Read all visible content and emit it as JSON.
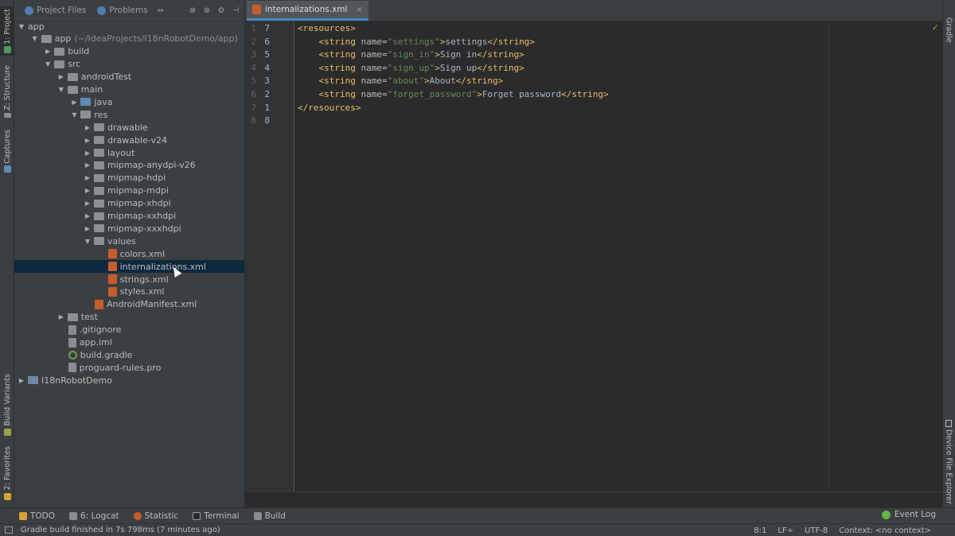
{
  "left_strip": {
    "tabs": [
      {
        "label": "1: Project",
        "icon": "project-icon",
        "active": true
      },
      {
        "label": "Z: Structure",
        "icon": "structure-icon"
      },
      {
        "label": "Captures",
        "icon": "captures-icon"
      },
      {
        "label": "Build Variants",
        "icon": "build-variants-icon"
      },
      {
        "label": "2: Favorites",
        "icon": "star-icon"
      }
    ]
  },
  "right_strip": {
    "tabs": [
      {
        "label": "Gradle",
        "icon": "gradle-icon"
      },
      {
        "label": "Device File Explorer",
        "icon": "device-icon"
      }
    ]
  },
  "project_panel": {
    "tabs": [
      {
        "label": "Project Files",
        "icon": "globe-icon"
      },
      {
        "label": "Problems",
        "icon": "globe-icon"
      }
    ],
    "tools": [
      "swap-icon",
      "collapse-icon",
      "scroll-from-source-icon",
      "gear-icon",
      "hide-icon"
    ],
    "tree": [
      {
        "depth": 0,
        "arrow": "down",
        "icon": "none",
        "label": "app"
      },
      {
        "depth": 1,
        "arrow": "down",
        "icon": "folder",
        "label": "app",
        "extra": "(~/IdeaProjects/I18nRobotDemo/app)"
      },
      {
        "depth": 2,
        "arrow": "right",
        "icon": "folder",
        "label": "build"
      },
      {
        "depth": 2,
        "arrow": "down",
        "icon": "folder",
        "label": "src"
      },
      {
        "depth": 3,
        "arrow": "right",
        "icon": "folder",
        "label": "androidTest"
      },
      {
        "depth": 3,
        "arrow": "down",
        "icon": "folder",
        "label": "main"
      },
      {
        "depth": 4,
        "arrow": "right",
        "icon": "folder-blue",
        "label": "java"
      },
      {
        "depth": 4,
        "arrow": "down",
        "icon": "folder",
        "label": "res"
      },
      {
        "depth": 5,
        "arrow": "right",
        "icon": "folder",
        "label": "drawable"
      },
      {
        "depth": 5,
        "arrow": "right",
        "icon": "folder",
        "label": "drawable-v24"
      },
      {
        "depth": 5,
        "arrow": "right",
        "icon": "folder",
        "label": "layout"
      },
      {
        "depth": 5,
        "arrow": "right",
        "icon": "folder",
        "label": "mipmap-anydpi-v26"
      },
      {
        "depth": 5,
        "arrow": "right",
        "icon": "folder",
        "label": "mipmap-hdpi"
      },
      {
        "depth": 5,
        "arrow": "right",
        "icon": "folder",
        "label": "mipmap-mdpi"
      },
      {
        "depth": 5,
        "arrow": "right",
        "icon": "folder",
        "label": "mipmap-xhdpi"
      },
      {
        "depth": 5,
        "arrow": "right",
        "icon": "folder",
        "label": "mipmap-xxhdpi"
      },
      {
        "depth": 5,
        "arrow": "right",
        "icon": "folder",
        "label": "mipmap-xxxhdpi"
      },
      {
        "depth": 5,
        "arrow": "down",
        "icon": "folder",
        "label": "values"
      },
      {
        "depth": 6,
        "arrow": "none",
        "icon": "xml",
        "label": "colors.xml"
      },
      {
        "depth": 6,
        "arrow": "none",
        "icon": "xml",
        "label": "internalizations.xml",
        "selected": true
      },
      {
        "depth": 6,
        "arrow": "none",
        "icon": "xml",
        "label": "strings.xml"
      },
      {
        "depth": 6,
        "arrow": "none",
        "icon": "xml",
        "label": "styles.xml"
      },
      {
        "depth": 5,
        "arrow": "none",
        "icon": "xml",
        "label": "AndroidManifest.xml"
      },
      {
        "depth": 3,
        "arrow": "right",
        "icon": "folder",
        "label": "test"
      },
      {
        "depth": 3,
        "arrow": "none",
        "icon": "plain",
        "label": ".gitignore"
      },
      {
        "depth": 3,
        "arrow": "none",
        "icon": "plain",
        "label": "app.iml"
      },
      {
        "depth": 3,
        "arrow": "none",
        "icon": "gradle",
        "label": "build.gradle"
      },
      {
        "depth": 3,
        "arrow": "none",
        "icon": "plain",
        "label": "proguard-rules.pro"
      },
      {
        "depth": 0,
        "arrow": "right",
        "icon": "module",
        "label": "I18nRobotDemo"
      }
    ]
  },
  "editor": {
    "tab": {
      "label": "internalizations.xml",
      "icon": "xml-file-icon"
    },
    "gutter": [
      {
        "a": "1",
        "b": "7"
      },
      {
        "a": "2",
        "b": "6"
      },
      {
        "a": "3",
        "b": "5"
      },
      {
        "a": "4",
        "b": "4"
      },
      {
        "a": "5",
        "b": "3"
      },
      {
        "a": "6",
        "b": "2"
      },
      {
        "a": "7",
        "b": "1"
      },
      {
        "a": "8",
        "b": "8"
      }
    ],
    "lines": [
      {
        "indent": "",
        "open": "<resources>",
        "attr": "",
        "val": "",
        "close_open": "",
        "text": "",
        "end": ""
      },
      {
        "indent": "    ",
        "open": "<string",
        "attr": " name=",
        "val": "\"settings\"",
        "close_open": ">",
        "text": "settings",
        "end": "</string>"
      },
      {
        "indent": "    ",
        "open": "<string",
        "attr": " name=",
        "val": "\"sign_in\"",
        "close_open": ">",
        "text": "Sign in",
        "end": "</string>"
      },
      {
        "indent": "    ",
        "open": "<string",
        "attr": " name=",
        "val": "\"sign_up\"",
        "close_open": ">",
        "text": "Sign up",
        "end": "</string>"
      },
      {
        "indent": "    ",
        "open": "<string",
        "attr": " name=",
        "val": "\"about\"",
        "close_open": ">",
        "text": "About",
        "end": "</string>"
      },
      {
        "indent": "    ",
        "open": "<string",
        "attr": " name=",
        "val": "\"forget_password\"",
        "close_open": ">",
        "text": "Forget password",
        "end": "</string>"
      },
      {
        "indent": "",
        "open": "</resources>",
        "attr": "",
        "val": "",
        "close_open": "",
        "text": "",
        "end": ""
      },
      {
        "indent": "",
        "open": "",
        "attr": "",
        "val": "",
        "close_open": "",
        "text": "",
        "end": ""
      }
    ]
  },
  "bottom_toolbar": {
    "items": [
      {
        "label": "TODO",
        "icon": "todo-icon"
      },
      {
        "label": "6: Logcat",
        "icon": "logcat-icon"
      },
      {
        "label": "Statistic",
        "icon": "statistic-icon"
      },
      {
        "label": "Terminal",
        "icon": "terminal-icon"
      },
      {
        "label": "Build",
        "icon": "build-icon"
      }
    ],
    "event_log": "Event Log"
  },
  "status_bar": {
    "message": "Gradle build finished in 7s 798ms (7 minutes ago)",
    "position": "8:1",
    "line_sep": "LF÷",
    "encoding": "UTF-8",
    "context": "Context: <no context>"
  },
  "colors": {
    "background": "#2b2b2b",
    "panel": "#3c3f41",
    "selection": "#0d293e",
    "tag": "#e8bf6a",
    "attr_value": "#6a8759",
    "accent": "#4a88c7"
  }
}
